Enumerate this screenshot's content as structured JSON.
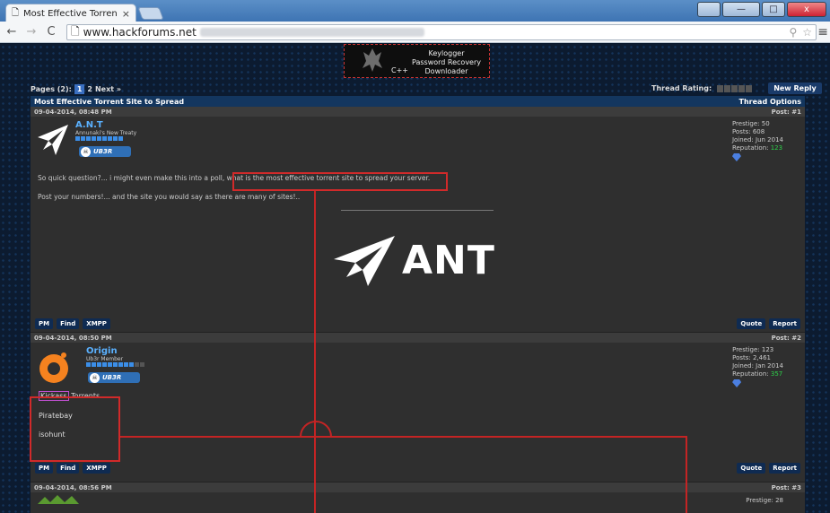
{
  "browser": {
    "tab_title": "Most Effective Torrent Site",
    "tab_close": "×",
    "url": "www.hackforums.net",
    "nav_back": "←",
    "nav_forward": "→",
    "nav_reload": "C",
    "page_icon": "🗋",
    "window_min": "—",
    "window_max": "□",
    "window_close": "x",
    "menu": "≡",
    "omni_search": "⚲",
    "omni_star": "☆"
  },
  "banner": {
    "items": [
      "Keylogger",
      "Password Recovery",
      "Downloader"
    ],
    "lang": "C++"
  },
  "pager": {
    "label": "Pages (2):",
    "pages": [
      "1",
      "2"
    ],
    "next": "Next »"
  },
  "rating": {
    "label": "Thread Rating:",
    "new_reply": "New Reply"
  },
  "thread": {
    "title": "Most Effective Torrent Site to Spread",
    "options": "Thread Options"
  },
  "posts": [
    {
      "date": "09-04-2014, 08:48 PM",
      "num": "Post: #1",
      "username": "A.N.T",
      "usertitle": "Annunaki's New Treaty",
      "badge": "UB3R",
      "stats": [
        "Prestige: 50",
        "Posts: 608",
        "Joined: Jun 2014"
      ],
      "rep_label": "Reputation: ",
      "rep": "123",
      "body_pre": "So quick question?... i might even make this into a poll,",
      "body_hl": "what is the most effective torrent site to spread your server.",
      "body2": "Post your numbers!... and the site you would say as there are many of sites!..",
      "sig_text": "ANT"
    },
    {
      "date": "09-04-2014, 08:50 PM",
      "num": "Post: #2",
      "username": "Origin",
      "usertitle": "Ub3r Member",
      "badge": "UB3R",
      "stats": [
        "Prestige: 123",
        "Posts: 2,461",
        "Joined: Jan 2014"
      ],
      "rep_label": "Reputation: ",
      "rep": "357",
      "list_kick": "Kickass",
      "list_kick_rest": " Torrents",
      "list2": "Piratebay",
      "list3": "isohunt"
    },
    {
      "date": "09-04-2014, 08:56 PM",
      "num": "Post: #3",
      "stats": [
        "Prestige: 28"
      ]
    }
  ],
  "buttons": {
    "pm": "PM",
    "find": "Find",
    "xmpp": "XMPP",
    "quote": "Quote",
    "report": "Report"
  }
}
